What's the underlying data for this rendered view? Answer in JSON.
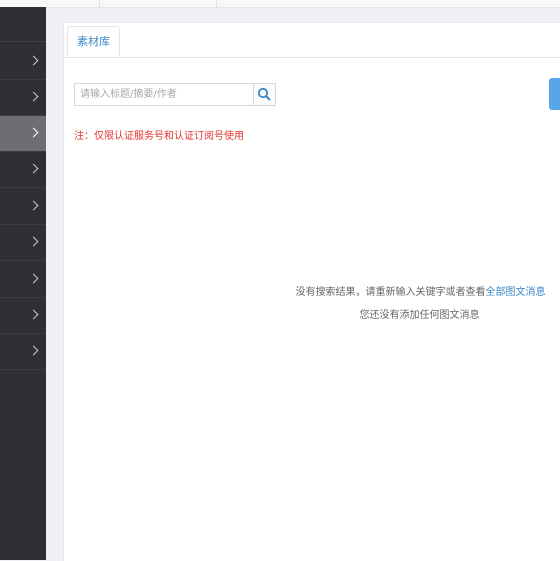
{
  "sidebar": {
    "item_count": 9,
    "active_index": 2
  },
  "tabs": [
    {
      "label": "素材库"
    }
  ],
  "search": {
    "placeholder": "请输入标题/摘要/作者",
    "value": ""
  },
  "notice": "注：仅限认证服务号和认证订阅号使用",
  "empty_state": {
    "line1_prefix": "没有搜索结果，请重新输入关键字或者查看",
    "line1_link": "全部图文消息",
    "line2": "您还没有添加任何图文消息"
  },
  "colors": {
    "sidebar_bg": "#2f3033",
    "accent": "#3b86c9",
    "notice": "#e5322d"
  }
}
